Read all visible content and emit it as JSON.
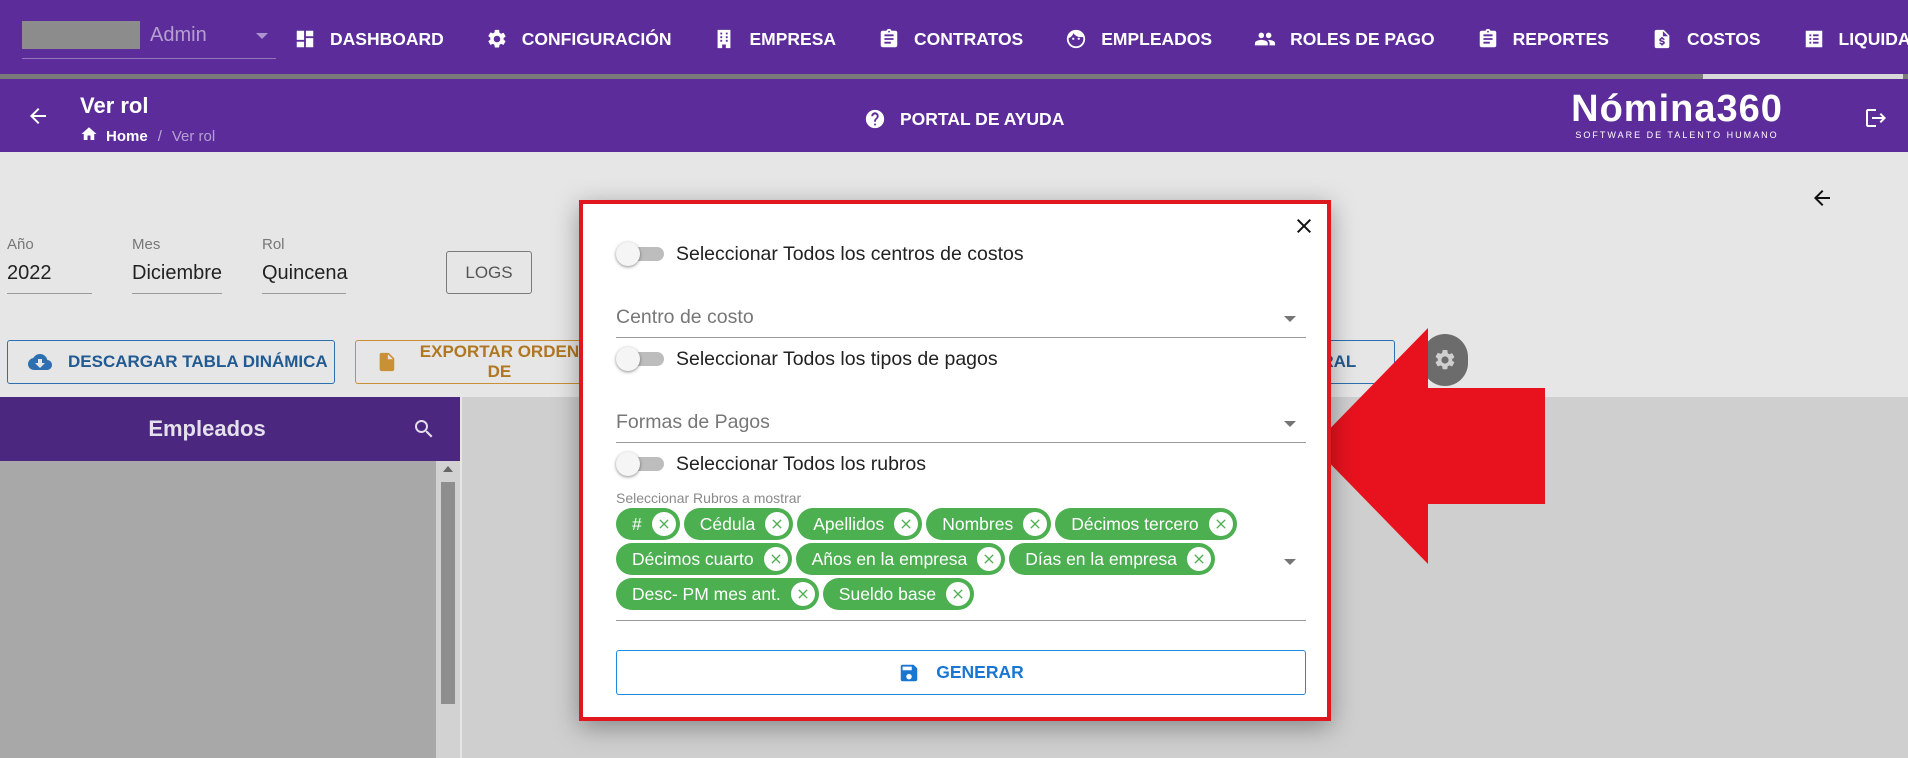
{
  "topnav": {
    "user_name": "Admin",
    "menu": [
      {
        "label": "DASHBOARD",
        "icon": "dashboard-icon"
      },
      {
        "label": "CONFIGURACIÓN",
        "icon": "gear-icon"
      },
      {
        "label": "EMPRESA",
        "icon": "building-icon"
      },
      {
        "label": "CONTRATOS",
        "icon": "clipboard-icon"
      },
      {
        "label": "EMPLEADOS",
        "icon": "face-icon"
      },
      {
        "label": "ROLES DE PAGO",
        "icon": "people-icon"
      },
      {
        "label": "REPORTES",
        "icon": "clipboard-icon"
      },
      {
        "label": "COSTOS",
        "icon": "dollar-file-icon"
      },
      {
        "label": "LIQUIDACIONES",
        "icon": "list-icon"
      }
    ],
    "colors": {
      "nav_bg": "#5b2c9a"
    }
  },
  "header": {
    "title": "Ver rol",
    "breadcrumb": {
      "home": "Home",
      "separator": "/",
      "current": "Ver rol"
    },
    "help_label": "PORTAL DE AYUDA",
    "logo": {
      "main": "Nómina360",
      "sub": "SOFTWARE DE TALENTO HUMANO"
    }
  },
  "filters": [
    {
      "label": "Año",
      "value": "2022"
    },
    {
      "label": "Mes",
      "value": "Diciembre"
    },
    {
      "label": "Rol",
      "value": "Quincena"
    }
  ],
  "logs_label": "LOGS",
  "actions": {
    "download_label": "DESCARGAR TABLA DINÁMICA",
    "export_label": "EXPORTAR ORDEN DE",
    "general_fragment": "ERAL"
  },
  "sidebar": {
    "title": "Empleados"
  },
  "modal": {
    "toggle_centros": "Seleccionar Todos los centros de costos",
    "centro_costo_placeholder": "Centro de costo",
    "toggle_pagos": "Seleccionar Todos los tipos de pagos",
    "formas_pago_placeholder": "Formas de Pagos",
    "toggle_rubros": "Seleccionar Todos los rubros",
    "rubros_label": "Seleccionar Rubros a mostrar",
    "chips": [
      "#",
      "Cédula",
      "Apellidos",
      "Nombres",
      "Décimos tercero",
      "Décimos cuarto",
      "Años en la empresa",
      "Días en la empresa",
      "Desc- PM mes ant.",
      "Sueldo base"
    ],
    "generar_label": "GENERAR",
    "colors": {
      "border": "#e0171f",
      "chip": "#4caf50",
      "button": "#1976d2"
    }
  }
}
